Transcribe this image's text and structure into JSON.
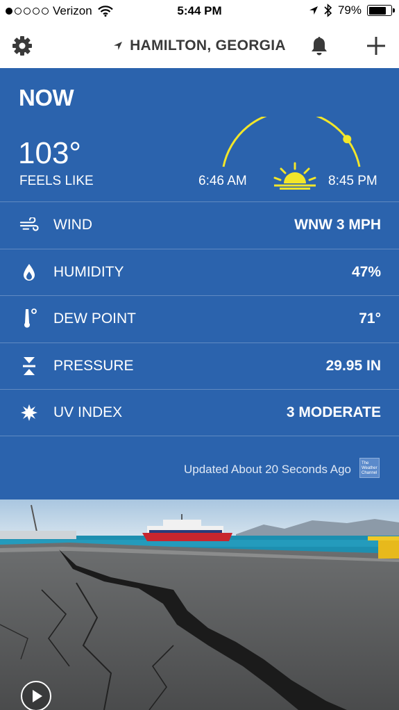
{
  "status_bar": {
    "carrier": "Verizon",
    "signal_dots_filled": 1,
    "signal_dots_total": 5,
    "time": "5:44 PM",
    "battery_percent_label": "79%",
    "battery_level": 0.79
  },
  "nav": {
    "location": "HAMILTON, GEORGIA",
    "settings_icon": "gear-icon",
    "location_icon": "location-arrow-icon",
    "alerts_icon": "bell-icon",
    "add_icon": "plus-icon"
  },
  "now": {
    "heading": "NOW",
    "temperature": "103°",
    "feels_like_label": "FEELS LIKE",
    "sunrise": "6:46 AM",
    "sunset": "8:45 PM",
    "sun_progress": 0.84
  },
  "conditions": [
    {
      "icon": "wind-icon",
      "label": "WIND",
      "value": "WNW 3 MPH"
    },
    {
      "icon": "humidity-drop-icon",
      "label": "HUMIDITY",
      "value": "47%"
    },
    {
      "icon": "thermometer-icon",
      "label": "DEW POINT",
      "value": "71°"
    },
    {
      "icon": "pressure-icon",
      "label": "PRESSURE",
      "value": "29.95 IN"
    },
    {
      "icon": "uv-sun-icon",
      "label": "UV INDEX",
      "value": "3 MODERATE"
    }
  ],
  "updated_text": "Updated About 20 Seconds Ago",
  "logo_text": "The Weather Channel",
  "colors": {
    "panel_blue": "#2b63ad",
    "sun_yellow": "#f2e62a"
  },
  "video": {
    "play_icon": "play-icon"
  }
}
